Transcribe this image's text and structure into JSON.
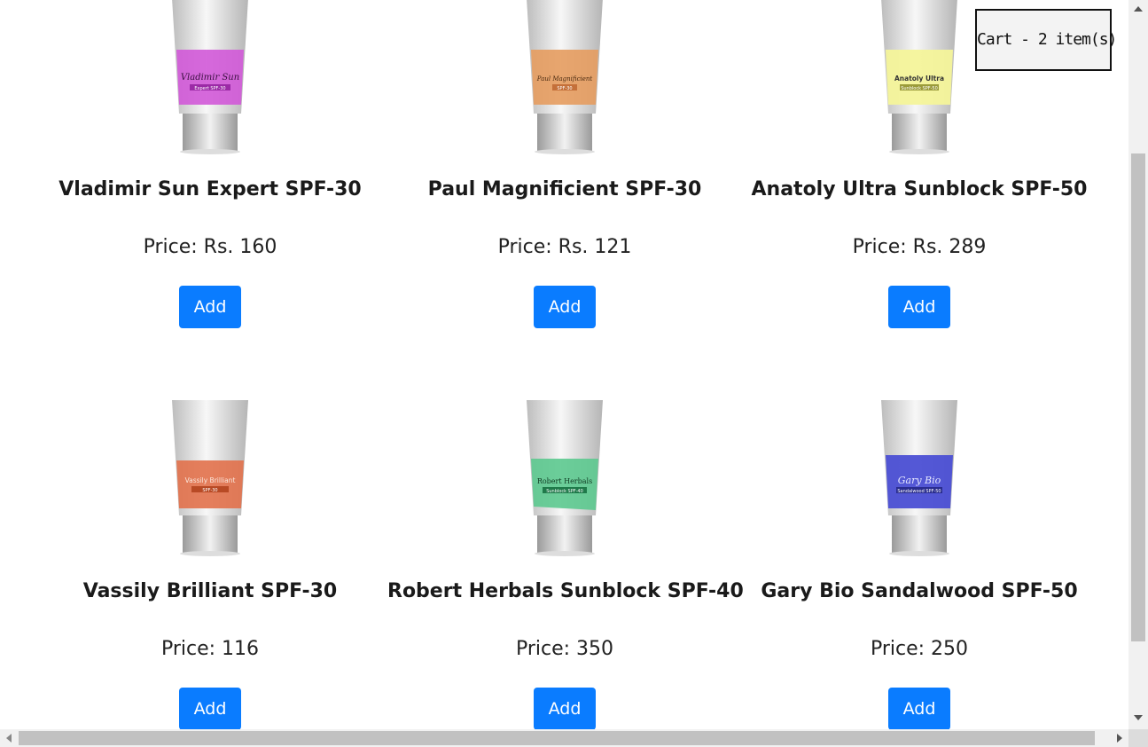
{
  "cart": {
    "label": "Cart - 2 item(s)"
  },
  "products": [
    {
      "name": "Vladimir Sun Expert SPF-30",
      "price": "Price: Rs. 160",
      "button": "Add",
      "tube_label_main": "Vladimir Sun",
      "tube_label_sub": "Expert SPF-30",
      "band_color": "#d259d8",
      "sub_color": "#9b2aa6"
    },
    {
      "name": "Paul Magnificient SPF-30",
      "price": "Price: Rs. 121",
      "button": "Add",
      "tube_label_main": "Paul Magnificient",
      "tube_label_sub": "SPF-30",
      "band_color": "#e59c5f",
      "sub_color": "#c4703a"
    },
    {
      "name": "Anatoly Ultra Sunblock SPF-50",
      "price": "Price: Rs. 289",
      "button": "Add",
      "tube_label_main": "Anatoly Ultra",
      "tube_label_sub": "Sunblock SPF-50",
      "band_color": "#f4f49a",
      "sub_color": "#9b9b3a"
    },
    {
      "name": "Vassily Brilliant SPF-30",
      "price": "Price: 116",
      "button": "Add",
      "tube_label_main": "Vassily Brilliant",
      "tube_label_sub": "SPF-30",
      "band_color": "#e2714b",
      "sub_color": "#b84a25"
    },
    {
      "name": "Robert Herbals Sunblock SPF-40",
      "price": "Price: 350",
      "button": "Add",
      "tube_label_main": "Robert Herbals",
      "tube_label_sub": "Sunblock SPF-40",
      "band_color": "#5cc98f",
      "sub_color": "#1f7a4a"
    },
    {
      "name": "Gary Bio Sandalwood SPF-50",
      "price": "Price: 250",
      "button": "Add",
      "tube_label_main": "Gary Bio",
      "tube_label_sub": "Sandalwood SPF-50",
      "band_color": "#4b4fd4",
      "sub_color": "#2a2d8f"
    }
  ],
  "colors": {
    "button_bg": "#0a7cff",
    "button_text": "#ffffff"
  }
}
